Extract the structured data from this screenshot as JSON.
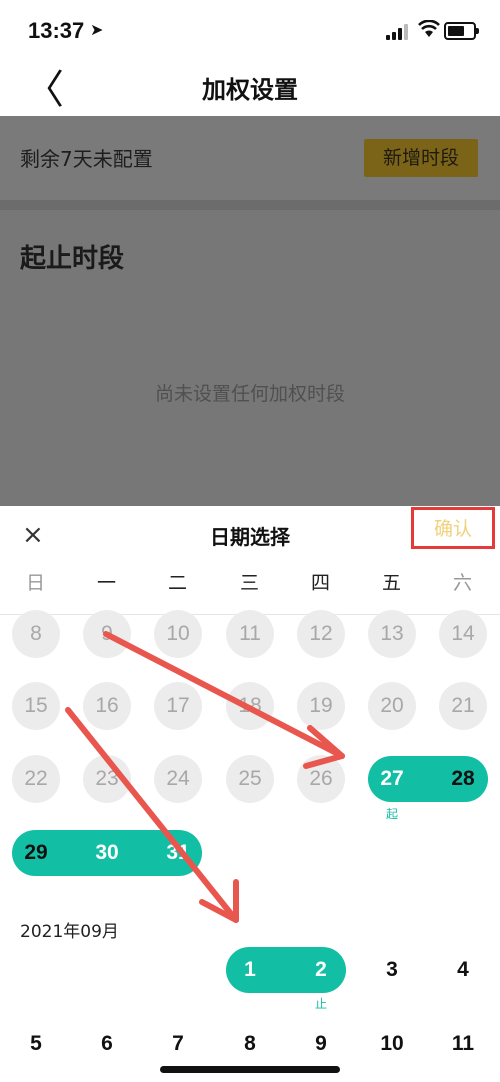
{
  "status_bar": {
    "time": "13:37",
    "location_glyph": "➤"
  },
  "nav": {
    "back_glyph": "〈",
    "title": "加权设置"
  },
  "page": {
    "remaining_text": "剩余7天未配置",
    "add_button": "新增时段",
    "section_title": "起止时段",
    "empty_text": "尚未设置任何加权时段"
  },
  "sheet": {
    "close_glyph": "×",
    "title": "日期选择",
    "confirm": "确认",
    "weekdays": [
      "日",
      "一",
      "二",
      "三",
      "四",
      "五",
      "六"
    ],
    "august": {
      "row1": [
        "8",
        "9",
        "10",
        "11",
        "12",
        "13",
        "14"
      ],
      "row2": [
        "15",
        "16",
        "17",
        "18",
        "19",
        "20",
        "21"
      ],
      "row3": [
        "22",
        "23",
        "24",
        "25",
        "26",
        "27",
        "28"
      ],
      "row4": [
        "29",
        "30",
        "31"
      ]
    },
    "start_tag": "起",
    "end_tag": "止",
    "september_label": "2021年09月",
    "september": {
      "row1": [
        "1",
        "2",
        "3",
        "4"
      ],
      "row2": [
        "5",
        "6",
        "7",
        "8",
        "9",
        "10",
        "11"
      ]
    }
  },
  "colors": {
    "accent": "#13bfa4",
    "confirm_highlight": "#e53a3a",
    "arrow": "#e8564e"
  }
}
